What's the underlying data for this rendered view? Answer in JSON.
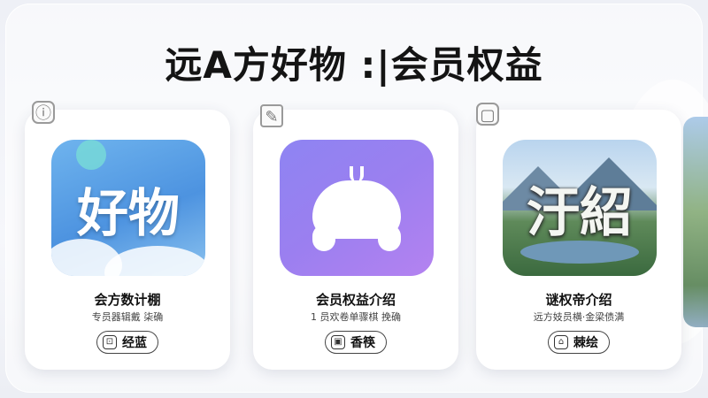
{
  "page": {
    "title": "远A方好物 :|会员权益"
  },
  "cards": [
    {
      "corner_icon": "info-icon",
      "tile_text": "好物",
      "title": "会方数计棚",
      "subtitle": "专员器辑戴 柒确",
      "button_label": "经蓝",
      "button_icon": "gift-icon"
    },
    {
      "corner_icon": "chat-icon",
      "tile_text": "",
      "title": "会员权益介绍",
      "subtitle": "1 员欢卷单骤棋 挽确",
      "button_label": "香筷",
      "button_icon": "ticket-icon"
    },
    {
      "corner_icon": "frame-icon",
      "tile_text": "汙紹",
      "title": "谜权帝介绍",
      "subtitle": "远方妓员横·金梁债满",
      "button_label": "棘绘",
      "button_icon": "home-icon"
    }
  ],
  "colors": {
    "accent_blue": "#4d93e0",
    "accent_purple": "#9b7ff0",
    "title_text": "#141414"
  }
}
